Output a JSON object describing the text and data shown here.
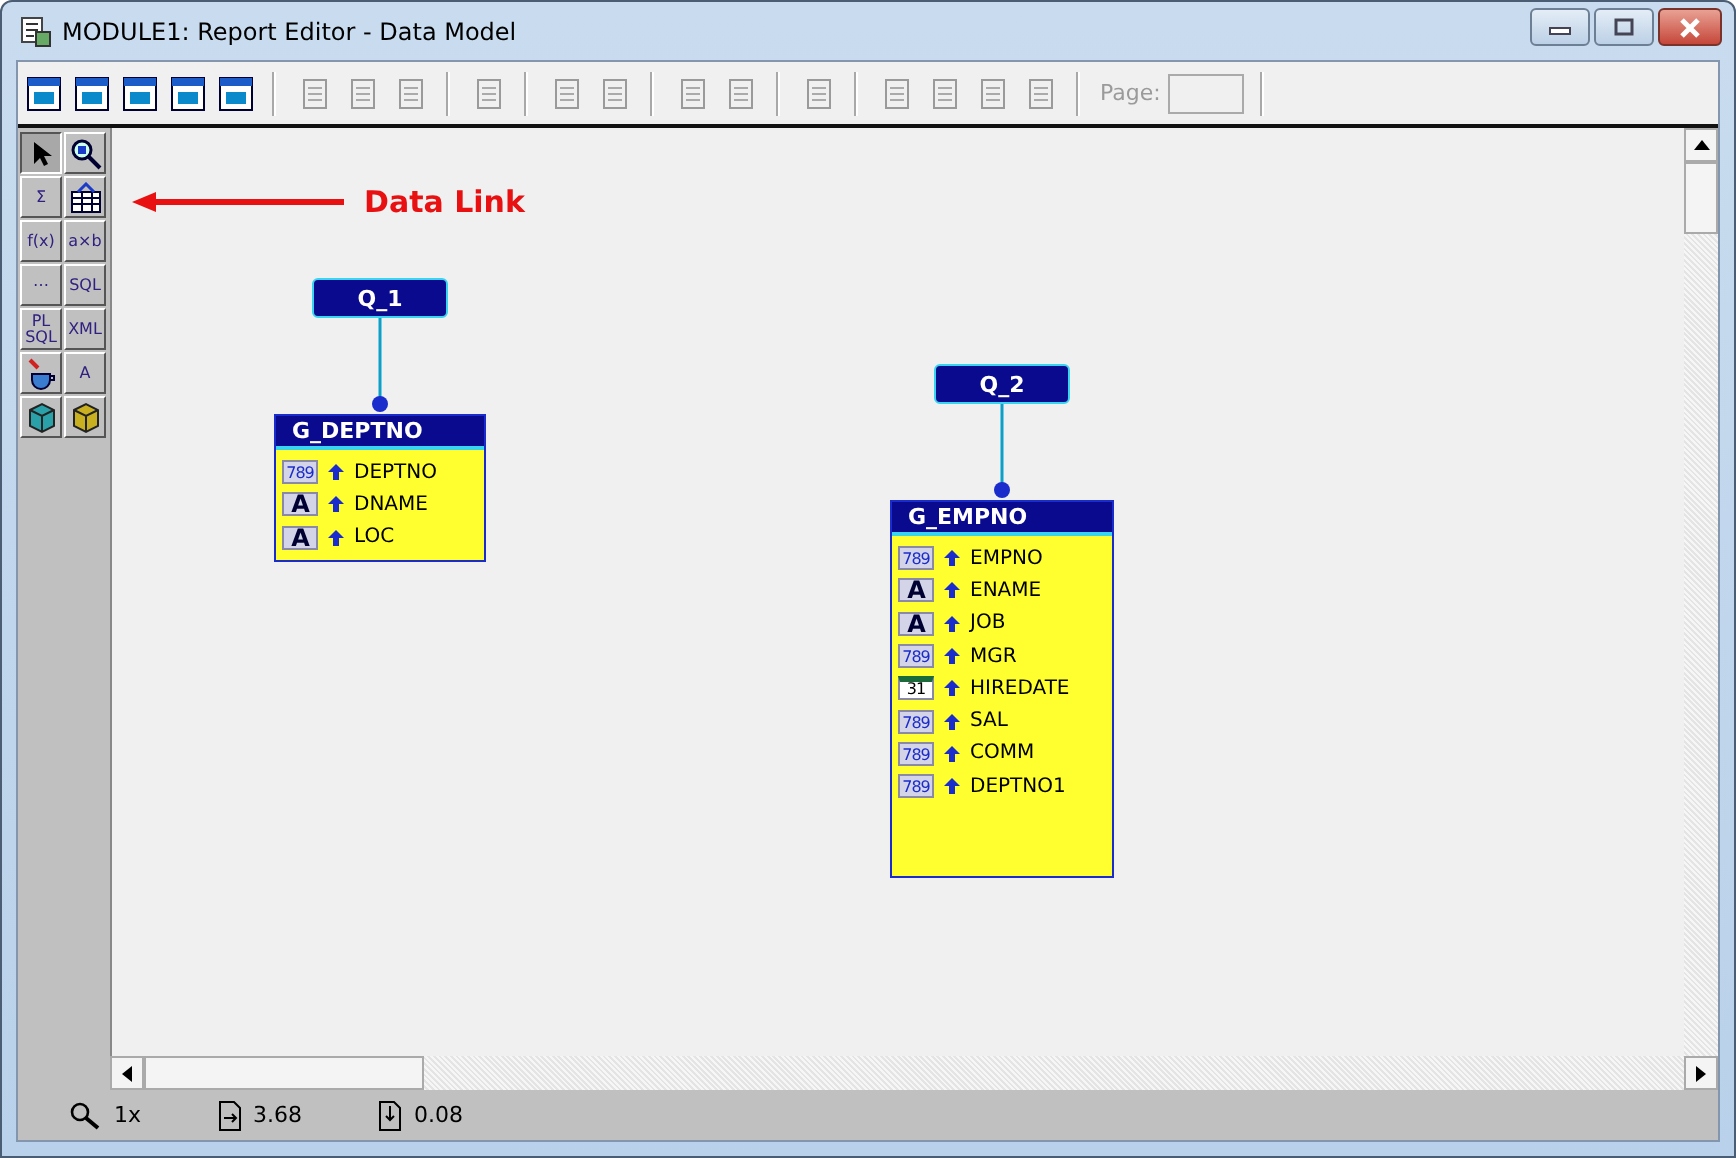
{
  "window": {
    "title": "MODULE1: Report Editor - Data Model"
  },
  "toolbar": {
    "groups": [
      [
        {
          "disabled": false
        },
        {
          "disabled": false
        },
        {
          "disabled": false
        },
        {
          "disabled": false
        },
        {
          "disabled": false
        }
      ],
      [
        {
          "disabled": true
        },
        {
          "disabled": true
        },
        {
          "disabled": true
        }
      ],
      [
        {
          "disabled": true
        }
      ],
      [
        {
          "disabled": true
        },
        {
          "disabled": true
        }
      ],
      [
        {
          "disabled": true
        },
        {
          "disabled": true
        }
      ],
      [
        {
          "disabled": true
        }
      ],
      [
        {
          "disabled": true
        },
        {
          "disabled": true
        },
        {
          "disabled": true
        },
        {
          "disabled": true
        }
      ]
    ],
    "page_label": "Page:"
  },
  "palette": [
    {
      "kind": "pointer",
      "selected": true
    },
    {
      "kind": "zoom",
      "selected": false
    },
    {
      "kind": "glyph",
      "glyph": "Σ",
      "selected": false
    },
    {
      "kind": "table",
      "selected": false
    },
    {
      "kind": "glyph",
      "glyph": "f(x)",
      "selected": false
    },
    {
      "kind": "glyph",
      "glyph": "a×b",
      "selected": false
    },
    {
      "kind": "glyph",
      "glyph": "⋯",
      "selected": false
    },
    {
      "kind": "glyph",
      "glyph": "SQL",
      "selected": false
    },
    {
      "kind": "glyph",
      "glyph": "PL SQL",
      "selected": false
    },
    {
      "kind": "glyph",
      "glyph": "XML",
      "selected": false
    },
    {
      "kind": "cup",
      "selected": false
    },
    {
      "kind": "glyph",
      "glyph": "A",
      "selected": false
    },
    {
      "kind": "cube",
      "color": "#2aa0a8",
      "selected": false
    },
    {
      "kind": "cube",
      "color": "#c8b020",
      "selected": false
    }
  ],
  "annotation": {
    "text": "Data Link"
  },
  "queries": [
    {
      "name": "Q_1",
      "group": {
        "name": "G_DEPTNO",
        "fields": [
          {
            "kind": "number",
            "icon": "789",
            "name": "DEPTNO"
          },
          {
            "kind": "text",
            "icon": "A",
            "name": "DNAME"
          },
          {
            "kind": "text",
            "icon": "A",
            "name": "LOC"
          }
        ]
      }
    },
    {
      "name": "Q_2",
      "group": {
        "name": "G_EMPNO",
        "fields": [
          {
            "kind": "number",
            "icon": "789",
            "name": "EMPNO"
          },
          {
            "kind": "text",
            "icon": "A",
            "name": "ENAME"
          },
          {
            "kind": "text",
            "icon": "A",
            "name": "JOB"
          },
          {
            "kind": "number",
            "icon": "789",
            "name": "MGR"
          },
          {
            "kind": "date",
            "icon": "31",
            "name": "HIREDATE"
          },
          {
            "kind": "number",
            "icon": "789",
            "name": "SAL"
          },
          {
            "kind": "number",
            "icon": "789",
            "name": "COMM"
          },
          {
            "kind": "number",
            "icon": "789",
            "name": "DEPTNO1"
          }
        ]
      }
    }
  ],
  "status_bar": [
    {
      "kind": "zoom",
      "text": "1x"
    },
    {
      "kind": "across",
      "text": "3.68"
    },
    {
      "kind": "down",
      "text": "0.08"
    }
  ]
}
